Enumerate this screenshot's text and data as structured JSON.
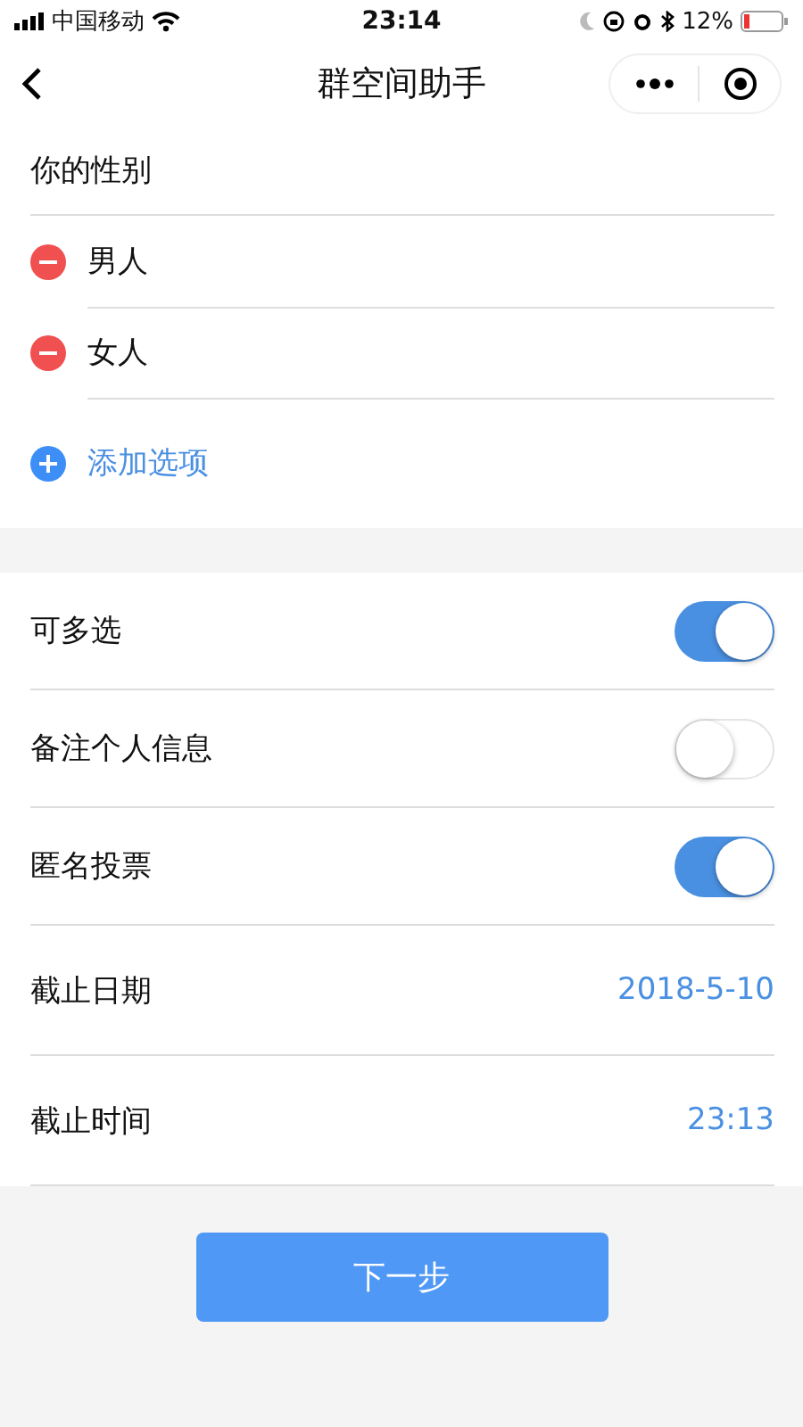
{
  "status_bar": {
    "carrier": "中国移动",
    "time": "23:14",
    "battery": "12%"
  },
  "nav": {
    "title": "群空间助手"
  },
  "question": {
    "title": "你的性别",
    "options": [
      "男人",
      "女人"
    ],
    "add_label": "添加选项"
  },
  "settings": [
    {
      "kind": "toggle",
      "label": "可多选",
      "on": true
    },
    {
      "kind": "toggle",
      "label": "备注个人信息",
      "on": false
    },
    {
      "kind": "toggle",
      "label": "匿名投票",
      "on": true
    },
    {
      "kind": "value",
      "label": "截止日期",
      "value": "2018-5-10"
    },
    {
      "kind": "value",
      "label": "截止时间",
      "value": "23:13"
    }
  ],
  "next_button": "下一步"
}
